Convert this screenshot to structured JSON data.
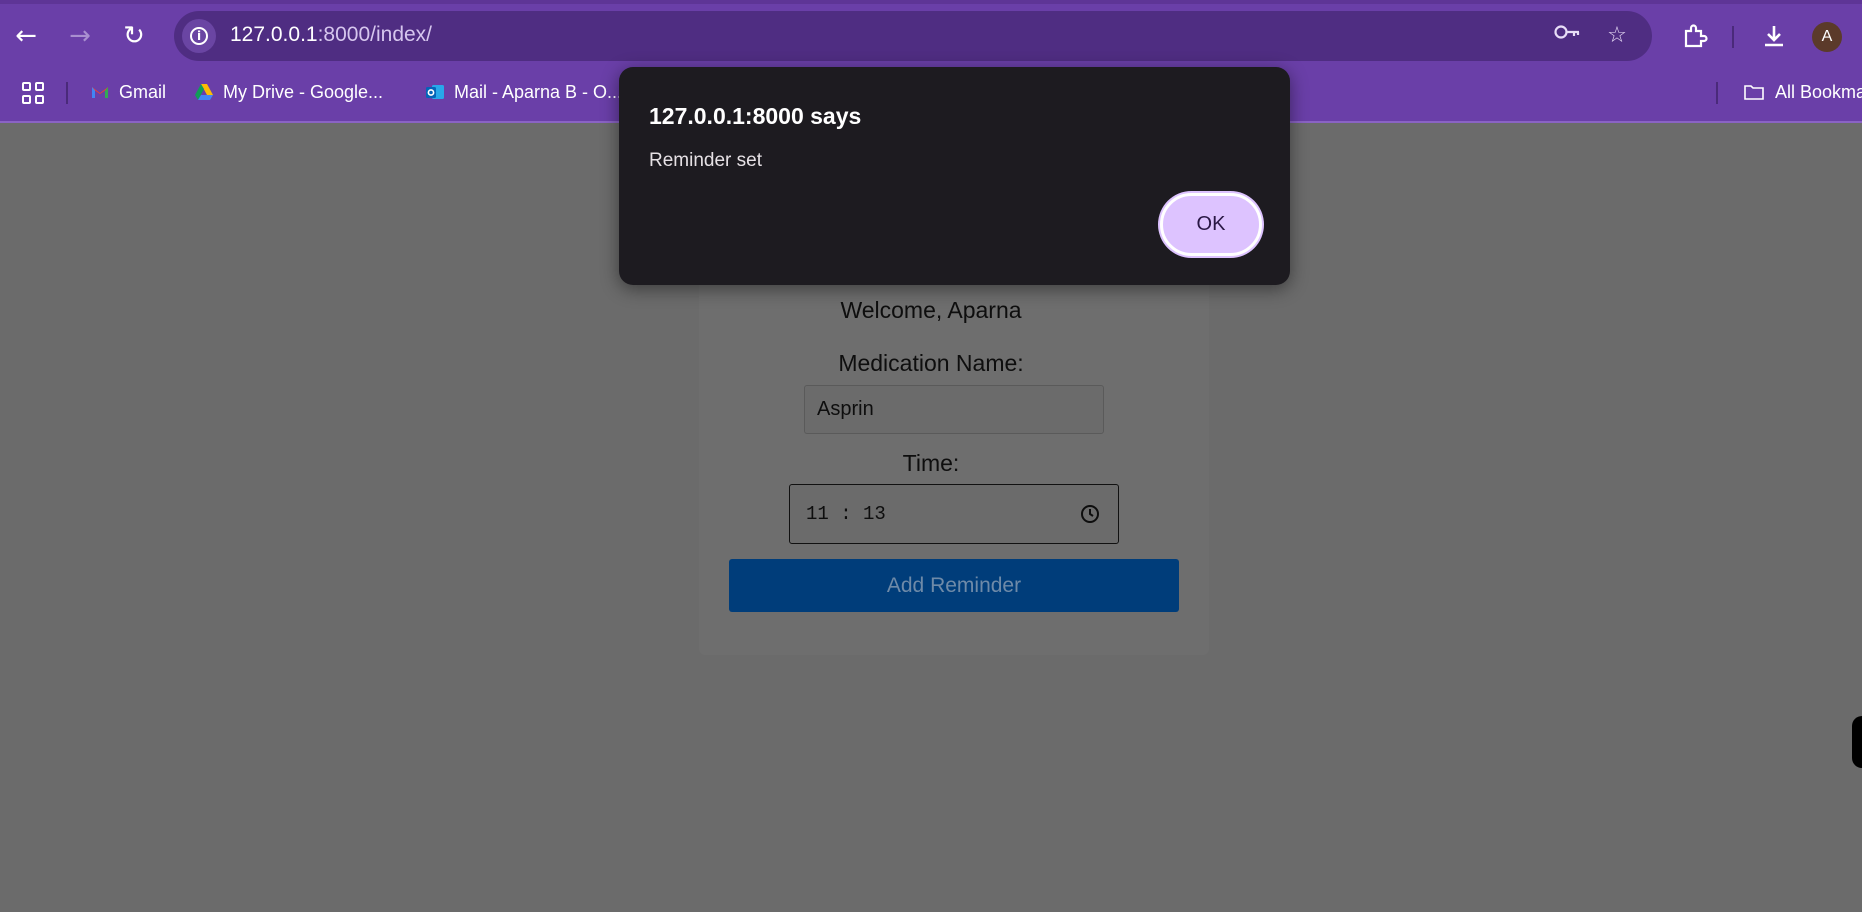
{
  "browser": {
    "url_host": "127.0.0.1",
    "url_rest": ":8000/index/",
    "avatar_letter": "A",
    "bookmarks": [
      {
        "label": "Gmail"
      },
      {
        "label": "My Drive - Google..."
      },
      {
        "label": "Mail - Aparna B - O..."
      }
    ],
    "all_bookmarks_label": "All Bookmarks"
  },
  "page": {
    "welcome": "Welcome, Aparna",
    "medication_label": "Medication Name:",
    "medication_value": "Asprin",
    "time_label": "Time:",
    "time_value": "11 : 13",
    "add_button": "Add Reminder"
  },
  "dialog": {
    "title": "127.0.0.1:8000 says",
    "message": "Reminder set",
    "ok_label": "OK"
  },
  "colors": {
    "chrome": "#6a3fa8",
    "omnibox": "#4f2d82",
    "dialog_bg": "#1d1b20",
    "ok_button": "#ddc3ff",
    "add_button": "#003d7a",
    "overlay": "#6b6b6b"
  }
}
